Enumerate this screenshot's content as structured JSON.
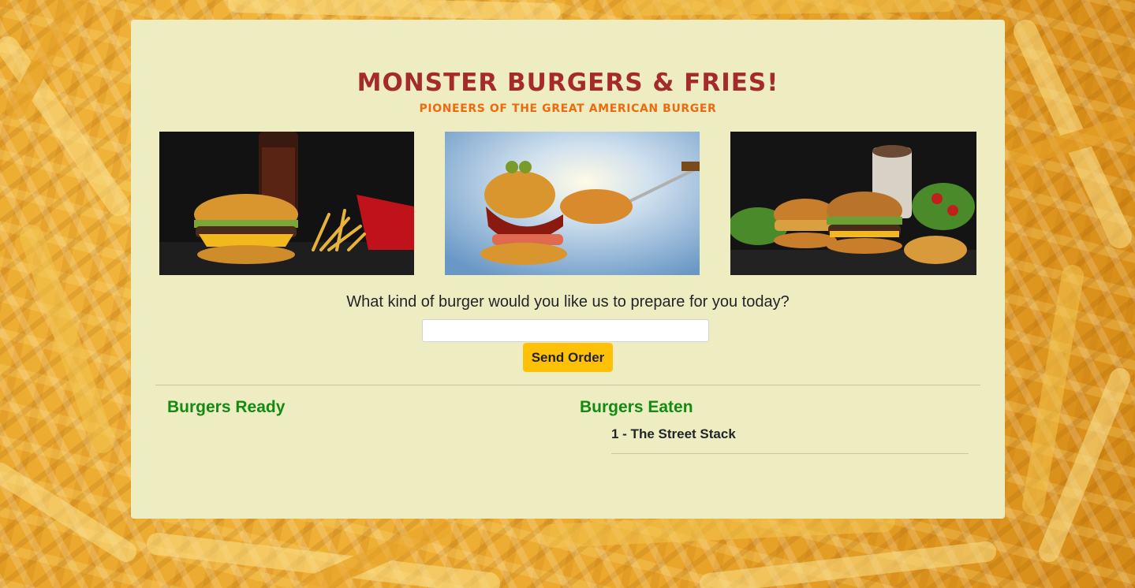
{
  "header": {
    "title": "Monster Burgers & Fries!",
    "subtitle": "Pioneers of the Great American Burger"
  },
  "gallery": [
    {
      "name": "burger-fries-cola-photo"
    },
    {
      "name": "monster-burger-photo"
    },
    {
      "name": "burgers-shake-photo"
    }
  ],
  "order": {
    "question": "What kind of burger would you like us to prepare for you today?",
    "input_value": "",
    "input_placeholder": "",
    "send_label": "Send Order"
  },
  "ready": {
    "heading": "Burgers Ready",
    "items": []
  },
  "eaten": {
    "heading": "Burgers Eaten",
    "items": [
      "1 - The Street Stack"
    ]
  },
  "colors": {
    "panel": "#eeedc1",
    "title": "#a52a2a",
    "subtitle": "#ee6a10",
    "button": "#ffc107",
    "heading": "#138a13"
  }
}
